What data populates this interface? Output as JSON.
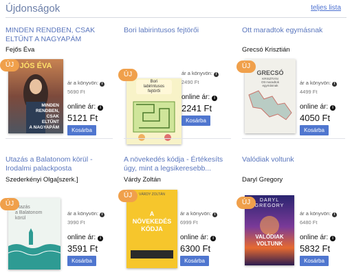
{
  "header": {
    "title": "Újdonságok",
    "all_link": "teljes lista"
  },
  "labels": {
    "list_price": "ár a könyvön:",
    "online_price": "online ár:",
    "cart": "Kosárba",
    "badge": "ÚJ",
    "info": "i"
  },
  "books": [
    {
      "title": "MINDEN RENDBEN, CSAK ELTŰNT A NAGYAPÁM",
      "author": "Fejős Éva",
      "list_price": "5690 Ft",
      "online_price": "5121 Ft",
      "cover_text": [
        "JÓS ÉVA",
        "MINDEN",
        "RENDBEN,",
        "CSAK",
        "ELTŰNT",
        "A NAGYAPÁM"
      ]
    },
    {
      "title": "Bori labirintusos fejtörői",
      "author": "",
      "list_price": "2490 Ft",
      "online_price": "2241 Ft",
      "cover_text": [
        "Bori",
        "labirintusos",
        "fejtörői"
      ]
    },
    {
      "title": "Ott maradtok egymásnak",
      "author": "Grecsó Krisztián",
      "list_price": "4499 Ft",
      "online_price": "4050 Ft",
      "cover_text": [
        "GRECSÓ",
        "KRISZTIÁN",
        "Ott maradtok",
        "egymásnak"
      ]
    },
    {
      "title": "Utazás a Balatonom körül - Irodalmi palackposta",
      "author": "Szederkényi Olga[szerk.]",
      "list_price": "3990 Ft",
      "online_price": "3591 Ft",
      "cover_text": [
        "Utazás",
        "a Balatonom",
        "körül"
      ]
    },
    {
      "title": "A növekedés kódja - Értékesíts úgy, mint a legsikeresebb...",
      "author": "Várdy Zoltán",
      "list_price": "6999 Ft",
      "online_price": "6300 Ft",
      "cover_text": [
        "VÁRDY ZOLTÁN",
        "A",
        "NÖVEKEDÉS",
        "KÓDJA"
      ]
    },
    {
      "title": "Valódiak voltunk",
      "author": "Daryl Gregory",
      "list_price": "6480 Ft",
      "online_price": "5832 Ft",
      "cover_text": [
        "DARYL",
        "GREGORY",
        "VALÓDIAK",
        "VOLTUNK"
      ]
    }
  ]
}
